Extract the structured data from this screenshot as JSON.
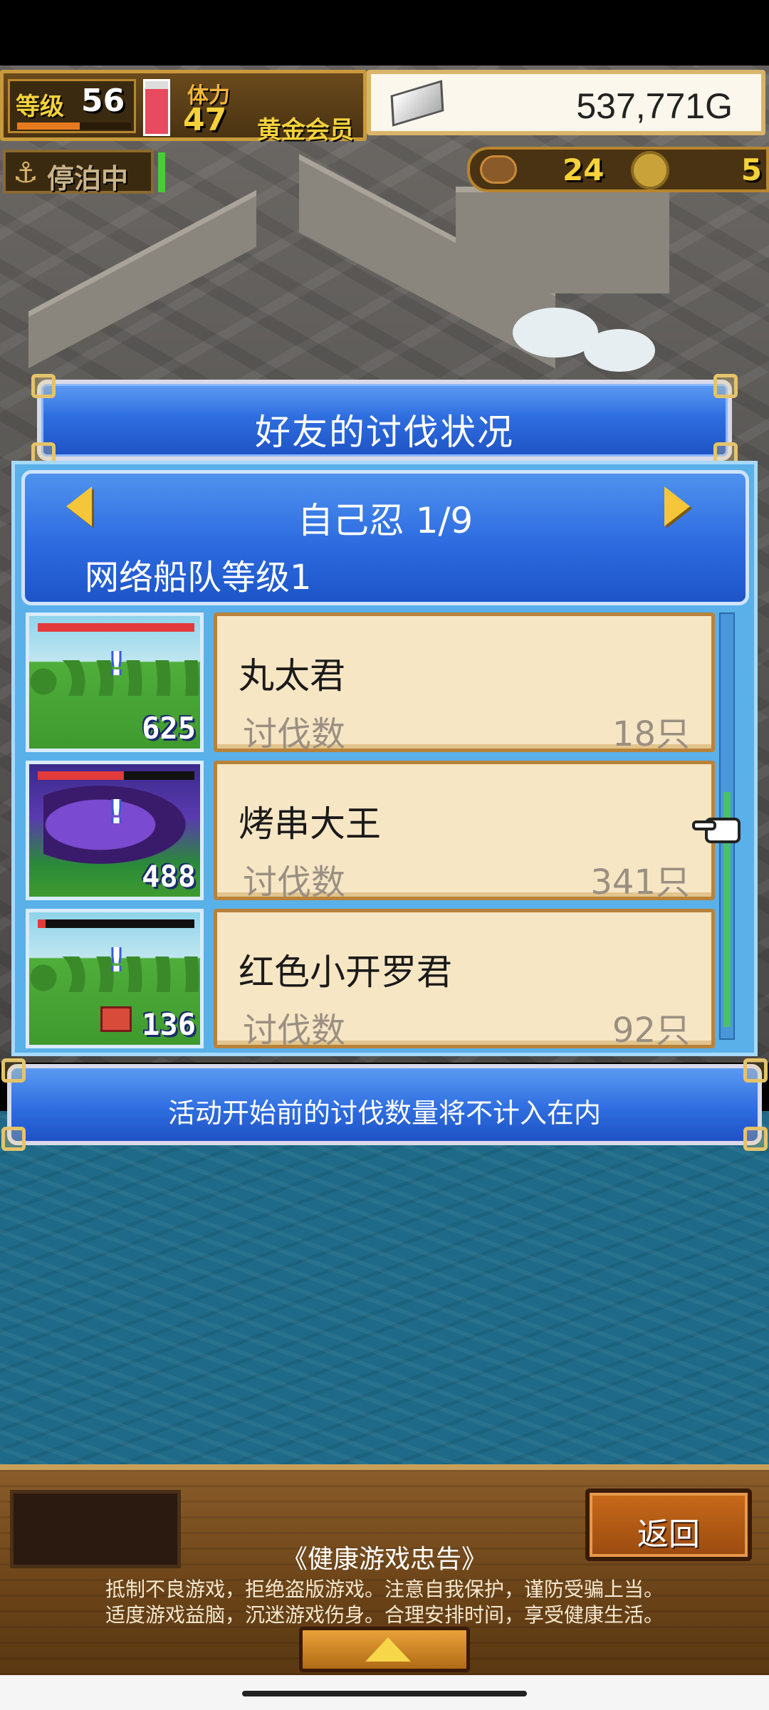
{
  "hud": {
    "level_label": "等级",
    "level": "56",
    "level_progress": 0.55,
    "stamina_label": "体力",
    "stamina": "47",
    "stamina_fill": 0.85,
    "membership": "黄金会员",
    "gold": "537,771G",
    "dock_status": "停泊中",
    "resource_1": "24",
    "resource_2": "5"
  },
  "dialog": {
    "title": "好友的讨伐状况",
    "friend_name": "自己忍 1/9",
    "fleet_level": "网络船队等级1",
    "stat_label": "讨伐数",
    "rows": [
      {
        "name": "丸太君",
        "count": "18只",
        "thumb_count": "625",
        "hp": 1.0,
        "hp_color": "#e23a3a"
      },
      {
        "name": "烤串大王",
        "count": "341只",
        "thumb_count": "488",
        "hp": 0.55,
        "hp_color": "#e23a3a"
      },
      {
        "name": "红色小开罗君",
        "count": "92只",
        "thumb_count": "136",
        "hp": 0.05,
        "hp_color": "#e23a3a"
      }
    ],
    "notice": "活动开始前的讨伐数量将不计入在内"
  },
  "footer": {
    "return_label": "返回",
    "health_title": "《健康游戏忠告》",
    "health_line1": "抵制不良游戏，拒绝盗版游戏。注意自我保护，谨防受骗上当。",
    "health_line2": "适度游戏益脑，沉迷游戏伤身。合理安排时间，享受健康生活。"
  },
  "colors": {
    "accent_blue": "#2f6ee0",
    "card_bg": "#f7e6c4",
    "gold_text": "#f5d23a"
  }
}
